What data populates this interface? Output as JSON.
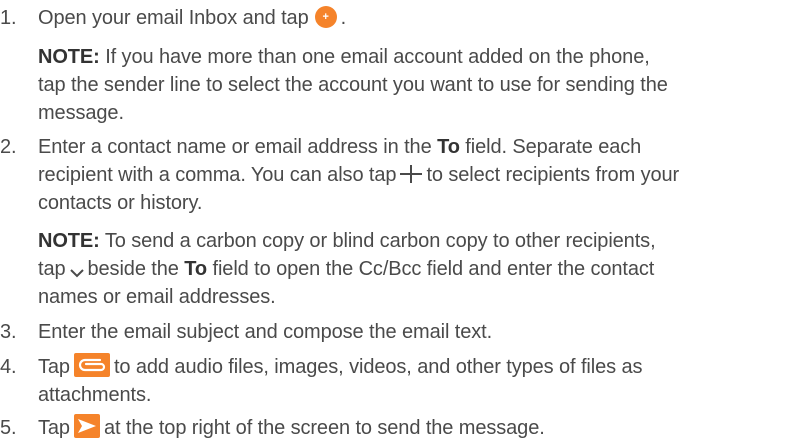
{
  "colors": {
    "text": "#4a4a4a",
    "accent": "#f5832a"
  },
  "icons": {
    "compose": "compose-plus-icon",
    "add_recipient": "plus-icon",
    "expand": "chevron-down-icon",
    "attach": "attachment-icon",
    "send": "send-icon"
  },
  "steps": [
    {
      "number": "1.",
      "line1_a": "Open your email Inbox and tap",
      "line1_b": "."
    },
    {
      "number": "2.",
      "line1_a": "Enter a contact name or email address in the",
      "line1_bold": "To",
      "line1_b": "field. Separate each",
      "line2_a": "recipient with a comma. You can also tap",
      "line2_b": "to select recipients from your",
      "line3": "contacts or history."
    },
    {
      "number": "3.",
      "line1": "Enter the email subject and compose the email text."
    },
    {
      "number": "4.",
      "line1_a": "Tap",
      "line1_b": "to add audio files, images, videos, and other types of files as",
      "line2": "attachments."
    },
    {
      "number": "5.",
      "line1_a": "Tap",
      "line1_b": "at the top right of the screen to send the message."
    }
  ],
  "notes": [
    {
      "label": "NOTE:",
      "line1": "If you have more than one email account added on the phone,",
      "line2": "tap the sender line to select the account you want to use for sending the",
      "line3": "message."
    },
    {
      "label": "NOTE:",
      "line1": "To send a carbon copy or blind carbon copy to other recipients,",
      "line2_a": "tap",
      "line2_b": "beside the",
      "line2_bold": "To",
      "line2_c": "field to open the Cc/Bcc field and enter the contact",
      "line3": "names or email addresses."
    }
  ]
}
